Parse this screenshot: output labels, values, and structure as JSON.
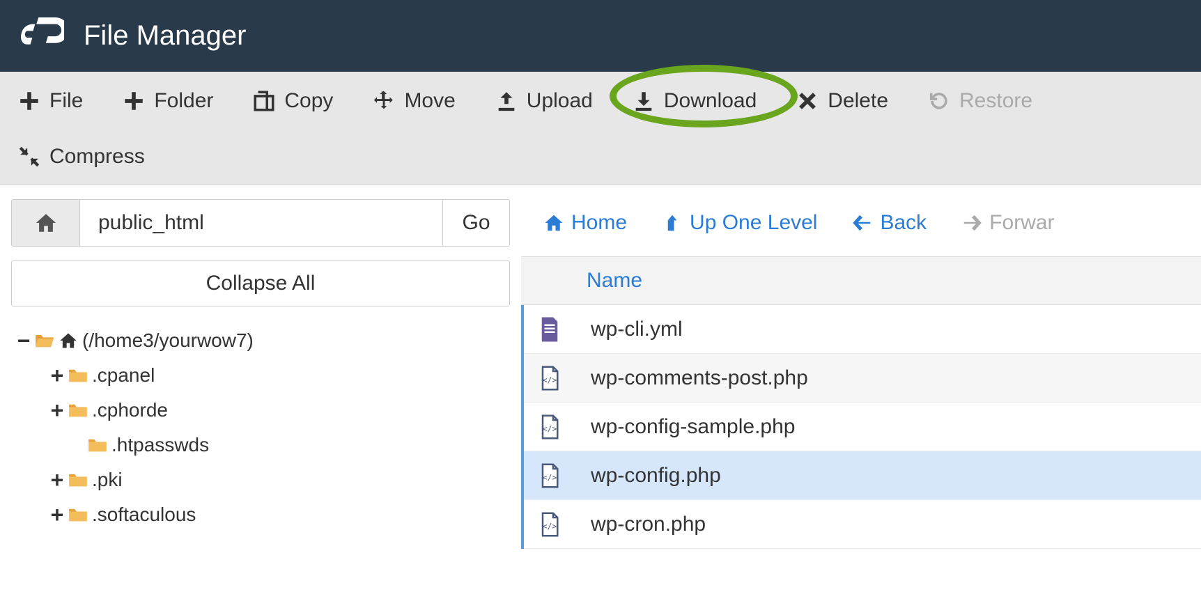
{
  "header": {
    "title": "File Manager"
  },
  "toolbar": {
    "file": "File",
    "folder": "Folder",
    "copy": "Copy",
    "move": "Move",
    "upload": "Upload",
    "download": "Download",
    "delete": "Delete",
    "restore": "Restore",
    "compress": "Compress"
  },
  "path": {
    "value": "public_html",
    "go": "Go"
  },
  "tree": {
    "collapse": "Collapse All",
    "root": "(/home3/yourwow7)",
    "items": [
      {
        "label": ".cpanel",
        "expandable": true
      },
      {
        "label": ".cphorde",
        "expandable": true
      },
      {
        "label": ".htpasswds",
        "expandable": false
      },
      {
        "label": ".pki",
        "expandable": true
      },
      {
        "label": ".softaculous",
        "expandable": true
      }
    ]
  },
  "nav": {
    "home": "Home",
    "up": "Up One Level",
    "back": "Back",
    "forward": "Forwar"
  },
  "grid": {
    "col_name": "Name",
    "rows": [
      {
        "name": "wp-cli.yml",
        "type": "yml",
        "selected": false,
        "alt": false
      },
      {
        "name": "wp-comments-post.php",
        "type": "php",
        "selected": false,
        "alt": true
      },
      {
        "name": "wp-config-sample.php",
        "type": "php",
        "selected": false,
        "alt": false
      },
      {
        "name": "wp-config.php",
        "type": "php",
        "selected": true,
        "alt": false
      },
      {
        "name": "wp-cron.php",
        "type": "php",
        "selected": false,
        "alt": false
      }
    ]
  }
}
